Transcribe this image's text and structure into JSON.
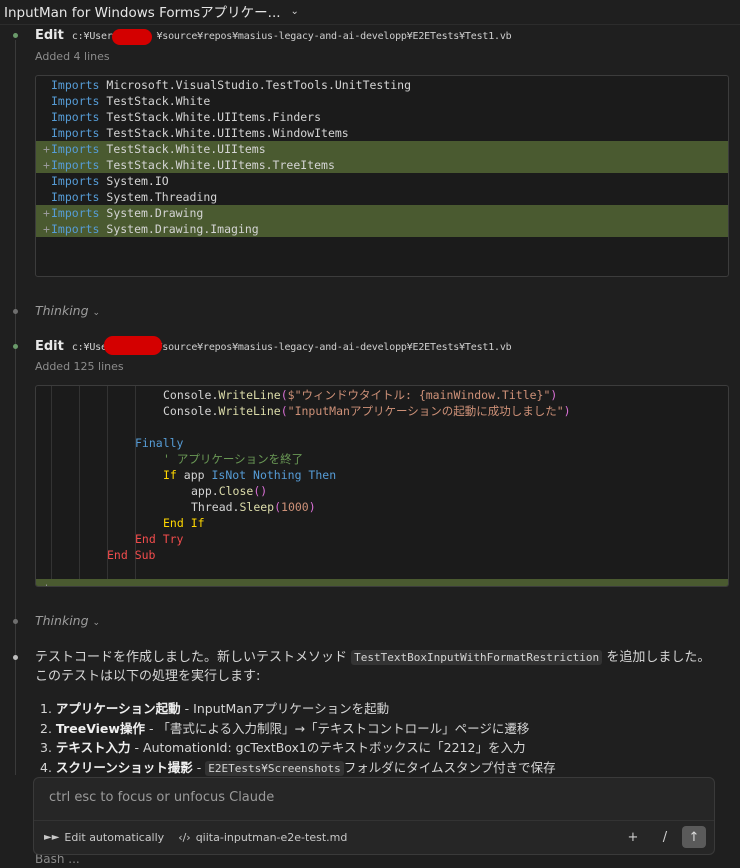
{
  "window": {
    "title": "InputMan for Windows Formsアプリケー..."
  },
  "edits": [
    {
      "label": "Edit",
      "path_prefix": "c:¥Users",
      "path_suffix": "¥source¥repos¥masius-legacy-and-ai-developp¥E2ETests¥Test1.vb",
      "summary": "Added 4 lines",
      "lines": [
        {
          "added": false,
          "keyword": "Imports",
          "text": " Microsoft.VisualStudio.TestTools.UnitTesting"
        },
        {
          "added": false,
          "keyword": "Imports",
          "text": " TestStack.White"
        },
        {
          "added": false,
          "keyword": "Imports",
          "text": " TestStack.White.UIItems.Finders"
        },
        {
          "added": false,
          "keyword": "Imports",
          "text": " TestStack.White.UIItems.WindowItems"
        },
        {
          "added": true,
          "keyword": "Imports",
          "text": " TestStack.White.UIItems"
        },
        {
          "added": true,
          "keyword": "Imports",
          "text": " TestStack.White.UIItems.TreeItems"
        },
        {
          "added": false,
          "keyword": "Imports",
          "text": " System.IO"
        },
        {
          "added": false,
          "keyword": "Imports",
          "text": " System.Threading"
        },
        {
          "added": true,
          "keyword": "Imports",
          "text": " System.Drawing"
        },
        {
          "added": true,
          "keyword": "Imports",
          "text": " System.Drawing.Imaging"
        }
      ]
    },
    {
      "label": "Edit",
      "path_prefix": "c:¥Users",
      "path_suffix": "¥source¥repos¥masius-legacy-and-ai-developp¥E2ETests¥Test1.vb",
      "summary": "Added 125 lines",
      "code": {
        "l1_obj": "Console.",
        "l1_fn": "WriteLine",
        "l1_open": "(",
        "l1_str": "$\"ウィンドウタイトル: {mainWindow.Title}\"",
        "l1_close": ")",
        "l2_obj": "Console.",
        "l2_fn": "WriteLine",
        "l2_open": "(",
        "l2_str": "\"InputManアプリケーションの起動に成功しました\"",
        "l2_close": ")",
        "finally": "Finally",
        "comment": "' アプリケーションを終了",
        "if": "If",
        "app": " app ",
        "isnot": "IsNot",
        "nothing": " Nothing",
        "then": " Then",
        "close_obj": "app.",
        "close_fn": "Close",
        "close_paren": "()",
        "sleep_obj": "Thread.",
        "sleep_fn": "Sleep",
        "sleep_open": "(",
        "sleep_num": "1000",
        "sleep_close": ")",
        "endif": "End If",
        "endtry": "End Try",
        "endsub": "End Sub"
      }
    }
  ],
  "thinking_label": "Thinking",
  "message": {
    "intro_1": "テストコードを作成しました。新しいテストメソッド ",
    "method": "TestTextBoxInputWithFormatRestriction",
    "intro_2": " を追加しました。 このテストは以下の処理を実行します:",
    "steps": [
      {
        "num": "1.",
        "bold": "アプリケーション起動",
        "text": " - InputManアプリケーションを起動"
      },
      {
        "num": "2.",
        "bold": "TreeView操作",
        "text": " - 「書式による入力制限」→「テキストコントロール」ページに遷移"
      },
      {
        "num": "3.",
        "bold": "テキスト入力",
        "text": " - AutomationId: gcTextBox1のテキストボックスに「2212」を入力"
      },
      {
        "num": "4.",
        "bold": "スクリーンショット撮影",
        "text_pre": " - ",
        "code": "E2ETests¥Screenshots",
        "text": "フォルダにタイムスタンプ付きで保存"
      }
    ]
  },
  "input": {
    "placeholder": "ctrl esc to focus or unfocus Claude",
    "mode_label": "Edit automatically",
    "file_label": "qiita-inputman-e2e-test.md",
    "add_symbol": "+",
    "slash_symbol": "/",
    "send_symbol": "↑"
  },
  "peek_text": "Bash  ...",
  "colors": {
    "background": "#1f1f1f",
    "added_line": "#4a5a30",
    "redaction": "#d40000",
    "keyword": "#569cd6"
  }
}
